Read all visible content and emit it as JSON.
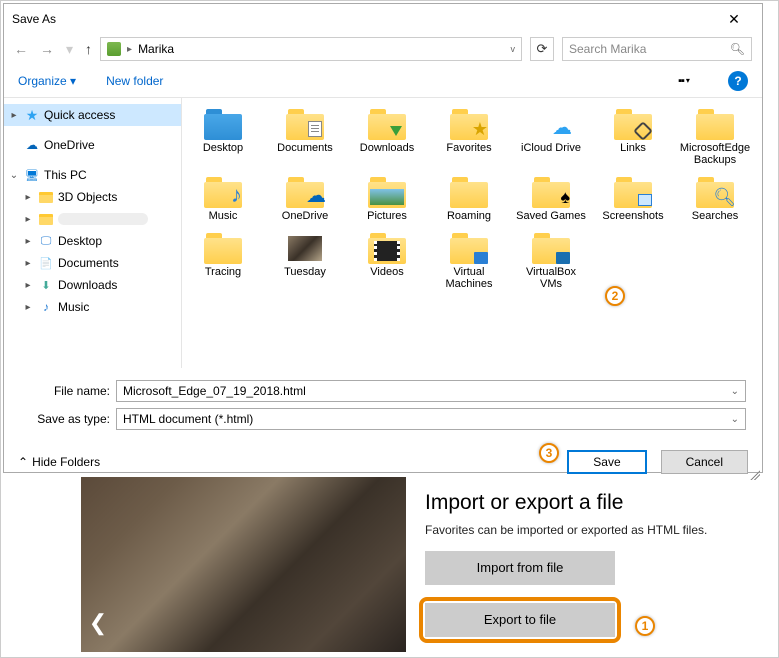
{
  "dialog": {
    "title": "Save As",
    "breadcrumb_user": "Marika",
    "search_placeholder": "Search Marika",
    "toolbar": {
      "organize": "Organize",
      "new_folder": "New folder"
    },
    "tree": {
      "quick_access": "Quick access",
      "onedrive": "OneDrive",
      "this_pc": "This PC",
      "pc3d": "3D Objects",
      "redacted": "",
      "desktop": "Desktop",
      "documents": "Documents",
      "downloads": "Downloads",
      "music": "Music"
    },
    "folders": [
      "Desktop",
      "Documents",
      "Downloads",
      "Favorites",
      "iCloud Drive",
      "Links",
      "MicrosoftEdgeBackups",
      "Music",
      "OneDrive",
      "Pictures",
      "Roaming",
      "Saved Games",
      "Screenshots",
      "Searches",
      "Tracing",
      "Tuesday",
      "Videos",
      "Virtual Machines",
      "VirtualBox VMs"
    ],
    "file_name_label": "File name:",
    "file_name_value": "Microsoft_Edge_07_19_2018.html",
    "save_as_type_label": "Save as type:",
    "save_as_type_value": "HTML document (*.html)",
    "hide_folders": "Hide Folders",
    "save_btn": "Save",
    "cancel_btn": "Cancel"
  },
  "edge": {
    "heading": "Import or export a file",
    "desc": "Favorites can be imported or exported as HTML files.",
    "import_btn": "Import from file",
    "export_btn": "Export to file"
  },
  "badges": {
    "one": "1",
    "two": "2",
    "three": "3"
  }
}
